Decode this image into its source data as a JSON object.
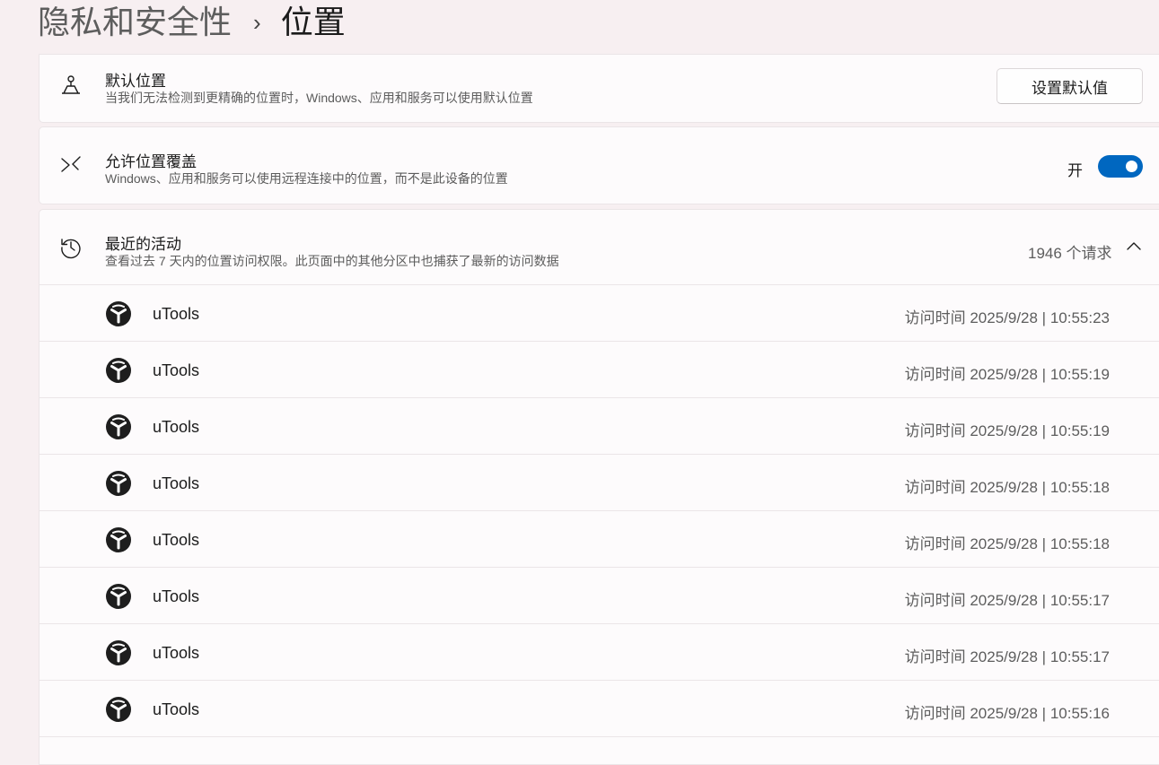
{
  "breadcrumb": {
    "parent": "隐私和安全性",
    "separator": "›",
    "current": "位置"
  },
  "default_location": {
    "icon": "map-pin-person-icon",
    "title": "默认位置",
    "description": "当我们无法检测到更精确的位置时，Windows、应用和服务可以使用默认位置",
    "button_label": "设置默认值"
  },
  "location_override": {
    "icon": "remote-arrows-icon",
    "title": "允许位置覆盖",
    "description": "Windows、应用和服务可以使用远程连接中的位置，而不是此设备的位置",
    "toggle_label": "开",
    "toggle_on": true,
    "accent_color": "#0067c0"
  },
  "recent_activity": {
    "icon": "history-icon",
    "title": "最近的活动",
    "description": "查看过去 7 天内的位置访问权限。此页面中的其他分区中也捕获了最新的访问数据",
    "request_count": "1946 个请求",
    "expanded": true,
    "items": [
      {
        "app": "uTools",
        "time": "访问时间 2025/9/28 | 10:55:23"
      },
      {
        "app": "uTools",
        "time": "访问时间 2025/9/28 | 10:55:19"
      },
      {
        "app": "uTools",
        "time": "访问时间 2025/9/28 | 10:55:19"
      },
      {
        "app": "uTools",
        "time": "访问时间 2025/9/28 | 10:55:18"
      },
      {
        "app": "uTools",
        "time": "访问时间 2025/9/28 | 10:55:18"
      },
      {
        "app": "uTools",
        "time": "访问时间 2025/9/28 | 10:55:17"
      },
      {
        "app": "uTools",
        "time": "访问时间 2025/9/28 | 10:55:17"
      },
      {
        "app": "uTools",
        "time": "访问时间 2025/9/28 | 10:55:16"
      }
    ]
  }
}
